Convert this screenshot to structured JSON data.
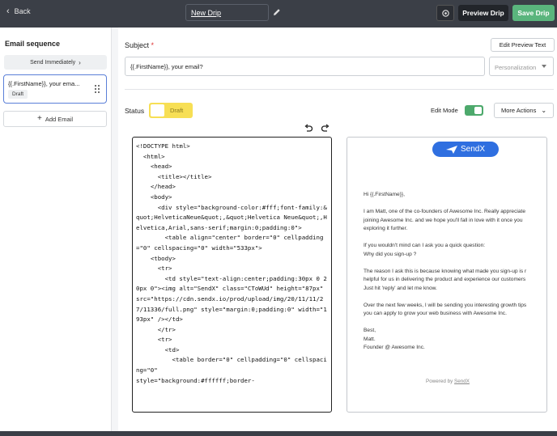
{
  "topbar": {
    "back_label": "Back",
    "drip_name": "New Drip",
    "preview_label": "Preview Drip",
    "save_label": "Save Drip"
  },
  "sidebar": {
    "heading": "Email sequence",
    "send_label": "Send Immediately",
    "email_subject": "{{.FirstName}}, your ema...",
    "email_status": "Draft",
    "add_email_label": "Add Email"
  },
  "main": {
    "subject_label": "Subject",
    "required_mark": "*",
    "edit_preview_label": "Edit Preview Text",
    "subject_value": "{{.FirstName}}, your email?",
    "personalization_placeholder": "Personalization",
    "status_label": "Status",
    "status_value": "Draft",
    "edit_mode_label": "Edit Mode",
    "edit_mode_on": true,
    "more_actions_label": "More Actions"
  },
  "editor": {
    "code": "<!DOCTYPE html>\n  <html>\n    <head>\n      <title></title>\n    </head>\n    <body>\n      <div style=\"background-color:#fff;font-family:&quot;HelveticaNeue&quot;,&quot;Helvetica Neue&quot;,Helvetica,Arial,sans-serif;margin:0;padding:0\">\n        <table align=\"center\" border=\"0\" cellpadding=\"0\" cellspacing=\"0\" width=\"533px\">\n    <tbody>\n      <tr>\n        <td style=\"text-align:center;padding:30px 0 20px 0\"><img alt=\"SendX\" class=\"CToWUd\" height=\"87px\" src=\"https://cdn.sendx.io/prod/upload/img/20/11/11/27/11336/full.png\" style=\"margin:0;padding:0\" width=\"193px\" /></td>\n      </tr>\n      <tr>\n        <td>\n          <table border=\"0\" cellpadding=\"0\" cellspacing=\"0\"\nstyle=\"background:#ffffff;border-"
  },
  "preview": {
    "logo_text": "SendX",
    "greeting": "Hi {{.FirstName}},",
    "para1_line1": "I am Matt, one of the co-founders of Awesome Inc. Really appreciate",
    "para1_line2": "joining Awesome Inc. and we hope you'll fall in love with it once you",
    "para1_line3": "exploring it further.",
    "para2_line1": "If you wouldn't mind can I ask you a quick question:",
    "para2_line2": "Why did you sign-up ?",
    "para3_line1": "The reason I ask this is because knowing what made you sign-up is r",
    "para3_line2": "helpful for us in delivering the product and experience our customers",
    "para3_line3": "Just hit 'reply' and let me know.",
    "para4_line1": "Over the next few weeks, I will be sending you interesting growth tips",
    "para4_line2": "you can apply to grow your web business with Awesome Inc.",
    "sign1": "Best,",
    "sign2": "Matt.",
    "sign3": "Founder @ Awesome Inc.",
    "powered_prefix": "Powered by",
    "powered_link": "SendX"
  },
  "colors": {
    "topbar": "#3b3f47",
    "save": "#5ab57d",
    "status_draft": "#f7df55",
    "toggle_on": "#4da96c",
    "selected_border": "#5a7fd8",
    "logo_blue": "#2f6fe0"
  }
}
